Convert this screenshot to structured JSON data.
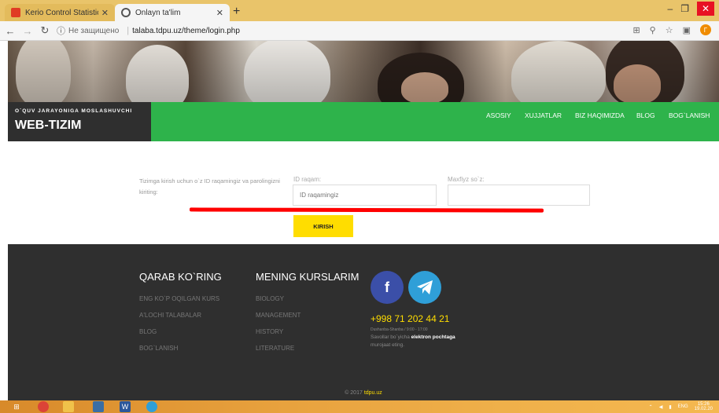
{
  "browser": {
    "tabs": [
      {
        "title": "Kerio Control Statistics - Kerio C...",
        "favicon_color": "#e03b24"
      },
      {
        "title": "Onlayn ta'lim",
        "favicon_color": "#555555"
      }
    ],
    "new_tab": "+",
    "address": {
      "insecure_label": "Не защищено",
      "url": "talaba.tdpu.uz/theme/login.php"
    },
    "profile_initial": "Γ"
  },
  "site": {
    "brand_sub": "O`QUV JARAYONIGA MOSLASHUVCHI",
    "brand_main": "WEB-TIZIM",
    "menu": [
      "ASOSIY",
      "XUJJATLAR",
      "BIZ HAQIMIZDA",
      "BLOG",
      "BOG`LANISH"
    ],
    "accent": "#2eb34b",
    "highlight": "#ffdd00"
  },
  "login": {
    "instructions": "Tizimga kirish uchun o`z ID raqamingiz va parolingizni kiriting:",
    "id_label": "ID raqam:",
    "id_placeholder": "ID raqamingiz",
    "password_label": "Maxfiyz so`z:",
    "password_value": "",
    "submit_label": "KIRISH"
  },
  "footer": {
    "col1_title": "QARAB KO`RING",
    "col1_links": [
      "ENG KO`P OQILGAN KURS",
      "A'LOCHI TALABALAR",
      "BLOG",
      "BOG`LANISH"
    ],
    "col2_title": "MENING KURSLARIM",
    "col2_links": [
      "BIOLOGY",
      "MANAGEMENT",
      "HISTORY",
      "LITERATURE"
    ],
    "facebook_glyph": "f",
    "phone": "+998 71 202 44 21",
    "hours": "Dushanba-Shanba / 9:00 - 17:00",
    "help_prefix": "Savollar bo`yicha",
    "help_bold": "elektron pochtaga",
    "help_suffix": "murojaat eting.",
    "copyright_prefix": "© 2017",
    "copyright_site": "tdpu.uz"
  },
  "taskbar": {
    "lang": "ENG",
    "time": "15:26",
    "date": "19.02.20"
  }
}
